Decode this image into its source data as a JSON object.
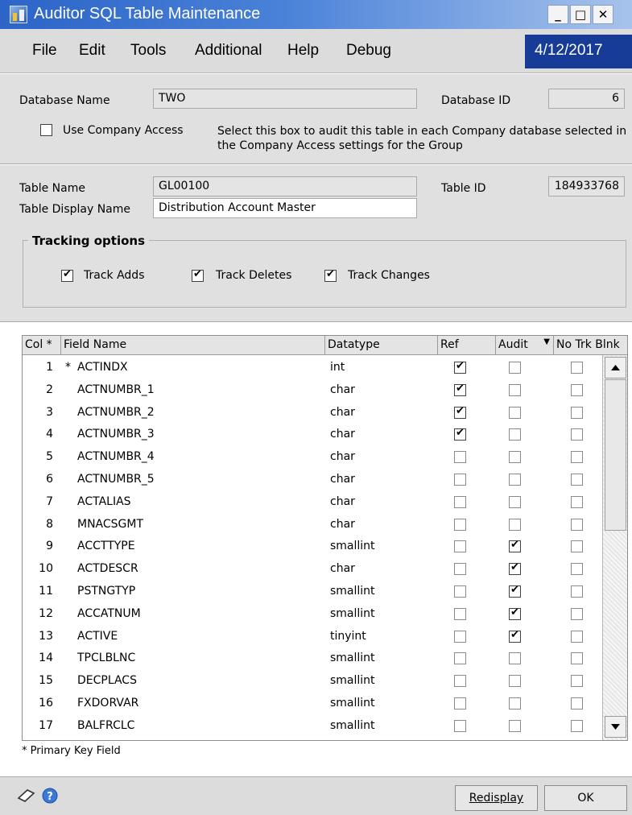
{
  "window": {
    "title": "Auditor SQL Table Maintenance",
    "min": "_",
    "max": "□",
    "close": "✕"
  },
  "menu": [
    "File",
    "Edit",
    "Tools",
    "Additional",
    "Help",
    "Debug"
  ],
  "date": "4/12/2017",
  "database": {
    "name_label": "Database Name",
    "name_value": "TWO",
    "id_label": "Database ID",
    "id_value": "6",
    "company_access_label": "Use Company Access",
    "company_access_checked": false,
    "company_access_help": "Select this box to audit this table in each Company database selected in the Company Access settings for the Group"
  },
  "table": {
    "name_label": "Table Name",
    "name_value": "GL00100",
    "id_label": "Table ID",
    "id_value": "184933768",
    "display_label": "Table Display Name",
    "display_value": "Distribution Account Master"
  },
  "tracking": {
    "title": "Tracking options",
    "adds_label": "Track Adds",
    "deletes_label": "Track Deletes",
    "changes_label": "Track Changes",
    "adds": true,
    "deletes": true,
    "changes": true
  },
  "grid": {
    "headers": {
      "col": "Col *",
      "field": "Field Name",
      "datatype": "Datatype",
      "ref": "Ref",
      "audit": "Audit",
      "notrk": "No Trk Blnk"
    },
    "rows": [
      {
        "col": "1",
        "pk": "*",
        "field": "ACTINDX",
        "type": "int",
        "ref": true,
        "audit": false,
        "notrk": false
      },
      {
        "col": "2",
        "pk": "",
        "field": "ACTNUMBR_1",
        "type": "char",
        "ref": true,
        "audit": false,
        "notrk": false
      },
      {
        "col": "3",
        "pk": "",
        "field": "ACTNUMBR_2",
        "type": "char",
        "ref": true,
        "audit": false,
        "notrk": false
      },
      {
        "col": "4",
        "pk": "",
        "field": "ACTNUMBR_3",
        "type": "char",
        "ref": true,
        "audit": false,
        "notrk": false
      },
      {
        "col": "5",
        "pk": "",
        "field": "ACTNUMBR_4",
        "type": "char",
        "ref": false,
        "audit": false,
        "notrk": false
      },
      {
        "col": "6",
        "pk": "",
        "field": "ACTNUMBR_5",
        "type": "char",
        "ref": false,
        "audit": false,
        "notrk": false
      },
      {
        "col": "7",
        "pk": "",
        "field": "ACTALIAS",
        "type": "char",
        "ref": false,
        "audit": false,
        "notrk": false
      },
      {
        "col": "8",
        "pk": "",
        "field": "MNACSGMT",
        "type": "char",
        "ref": false,
        "audit": false,
        "notrk": false
      },
      {
        "col": "9",
        "pk": "",
        "field": "ACCTTYPE",
        "type": "smallint",
        "ref": false,
        "audit": true,
        "notrk": false
      },
      {
        "col": "10",
        "pk": "",
        "field": "ACTDESCR",
        "type": "char",
        "ref": false,
        "audit": true,
        "notrk": false
      },
      {
        "col": "11",
        "pk": "",
        "field": "PSTNGTYP",
        "type": "smallint",
        "ref": false,
        "audit": true,
        "notrk": false
      },
      {
        "col": "12",
        "pk": "",
        "field": "ACCATNUM",
        "type": "smallint",
        "ref": false,
        "audit": true,
        "notrk": false
      },
      {
        "col": "13",
        "pk": "",
        "field": "ACTIVE",
        "type": "tinyint",
        "ref": false,
        "audit": true,
        "notrk": false
      },
      {
        "col": "14",
        "pk": "",
        "field": "TPCLBLNC",
        "type": "smallint",
        "ref": false,
        "audit": false,
        "notrk": false
      },
      {
        "col": "15",
        "pk": "",
        "field": "DECPLACS",
        "type": "smallint",
        "ref": false,
        "audit": false,
        "notrk": false
      },
      {
        "col": "16",
        "pk": "",
        "field": "FXDORVAR",
        "type": "smallint",
        "ref": false,
        "audit": false,
        "notrk": false
      },
      {
        "col": "17",
        "pk": "",
        "field": "BALFRCLC",
        "type": "smallint",
        "ref": false,
        "audit": false,
        "notrk": false
      }
    ]
  },
  "footnote": "* Primary Key Field",
  "buttons": {
    "redisplay": "Redisplay",
    "ok": "OK"
  },
  "icons": [
    "app-icon",
    "note-icon",
    "help-icon",
    "sort-arrow-icon",
    "scroll-up-icon",
    "scroll-down-icon"
  ]
}
